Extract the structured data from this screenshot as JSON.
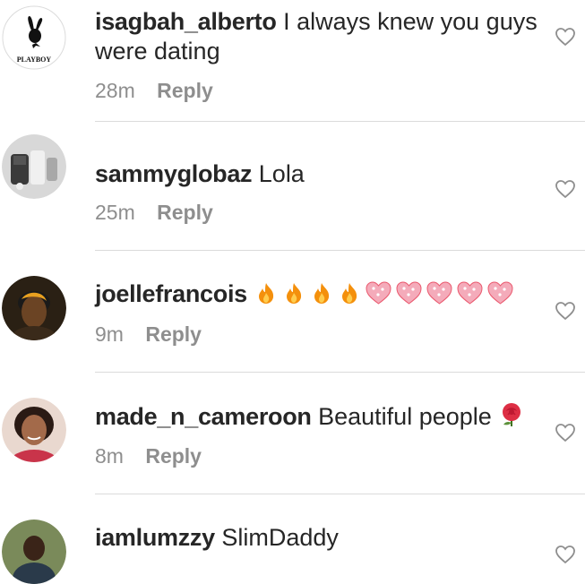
{
  "comments": [
    {
      "username": "isagbah_alberto",
      "text": "I always knew you guys were dating",
      "time": "28m",
      "reply_label": "Reply",
      "avatar": "playboy-logo-avatar",
      "avatar_text": "PLAYBOY"
    },
    {
      "username": "sammyglobaz",
      "text": "Lola",
      "time": "25m",
      "reply_label": "Reply",
      "avatar": "jacket-photo-avatar"
    },
    {
      "username": "joellefrancois",
      "text": "",
      "time": "9m",
      "reply_label": "Reply",
      "avatar": "profile-photo-avatar",
      "emojis": [
        "fire-emoji",
        "fire-emoji",
        "fire-emoji",
        "fire-emoji",
        "sparkling-heart-emoji",
        "sparkling-heart-emoji",
        "sparkling-heart-emoji",
        "sparkling-heart-emoji",
        "sparkling-heart-emoji"
      ]
    },
    {
      "username": "made_n_cameroon",
      "text": "Beautiful people",
      "time": "8m",
      "reply_label": "Reply",
      "avatar": "profile-photo-avatar",
      "emojis": [
        "rose-emoji"
      ]
    },
    {
      "username": "iamlumzzy",
      "text": "SlimDaddy",
      "time": "",
      "reply_label": "",
      "avatar": "profile-photo-avatar"
    }
  ],
  "colors": {
    "text": "#262626",
    "meta": "#8e8e8e",
    "divider": "#dbdbdb",
    "fire": "#f4900c",
    "heart": "#f4abba"
  },
  "icons": {
    "like": "heart-outline-icon"
  }
}
